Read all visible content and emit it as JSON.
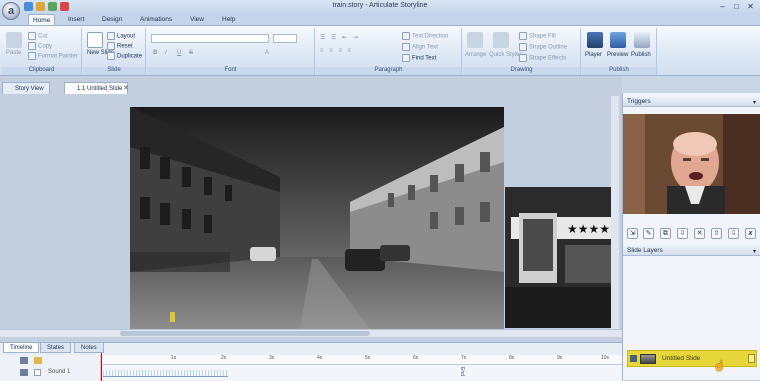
{
  "window": {
    "title": "train.story - Articulate Storyline",
    "minimize": "–",
    "maximize": "□",
    "close": "✕"
  },
  "ribbon_tabs": [
    "Home",
    "Insert",
    "Design",
    "Animations",
    "View",
    "Help"
  ],
  "ribbon": {
    "clipboard": {
      "label": "Clipboard",
      "paste": "Paste",
      "cut": "Cut",
      "copy": "Copy",
      "format_painter": "Format Painter"
    },
    "slide": {
      "label": "Slide",
      "new_slide": "New Slide",
      "layout": "Layout",
      "reset": "Reset",
      "duplicate": "Duplicate"
    },
    "font": {
      "label": "Font",
      "font_name": "",
      "font_size": "",
      "bold": "B",
      "italic": "I",
      "underline": "U",
      "strike": "S",
      "clear": "A"
    },
    "paragraph": {
      "label": "Paragraph",
      "text_direction": "Text Direction",
      "align_text": "Align Text",
      "find_text": "Find Text"
    },
    "drawing": {
      "label": "Drawing",
      "arrange": "Arrange",
      "quick_styles": "Quick Styles",
      "shape_fill": "Shape Fill",
      "shape_outline": "Shape Outline",
      "shape_effects": "Shape Effects"
    },
    "publish": {
      "label": "Publish",
      "player": "Player",
      "preview": "Preview",
      "publish": "Publish"
    }
  },
  "view_tabs": {
    "story_view": "Story View",
    "slide_tab": "1.1 Untitled Slide"
  },
  "timeline": {
    "tabs": [
      "Timeline",
      "States",
      "Notes"
    ],
    "ticks": [
      "1s",
      "2s",
      "3s",
      "4s",
      "5s",
      "6s",
      "7s",
      "8s",
      "9s",
      "10s"
    ],
    "tracks": [
      {
        "name": "Sound 1"
      }
    ],
    "end_label": "End"
  },
  "right_panel": {
    "triggers_label": "Triggers",
    "slide_layers_label": "Slide Layers",
    "trigger_buttons": [
      "⇲",
      "✎",
      "⧉",
      "⇩",
      "✕",
      "⇧",
      "⇩",
      "x"
    ],
    "layers": [
      {
        "name": "Untitled Slide"
      }
    ]
  },
  "colors": {
    "layer_highlight": "#e6d83a",
    "ribbon_bg": "#dde8f5",
    "accent": "#3a6fb5"
  }
}
